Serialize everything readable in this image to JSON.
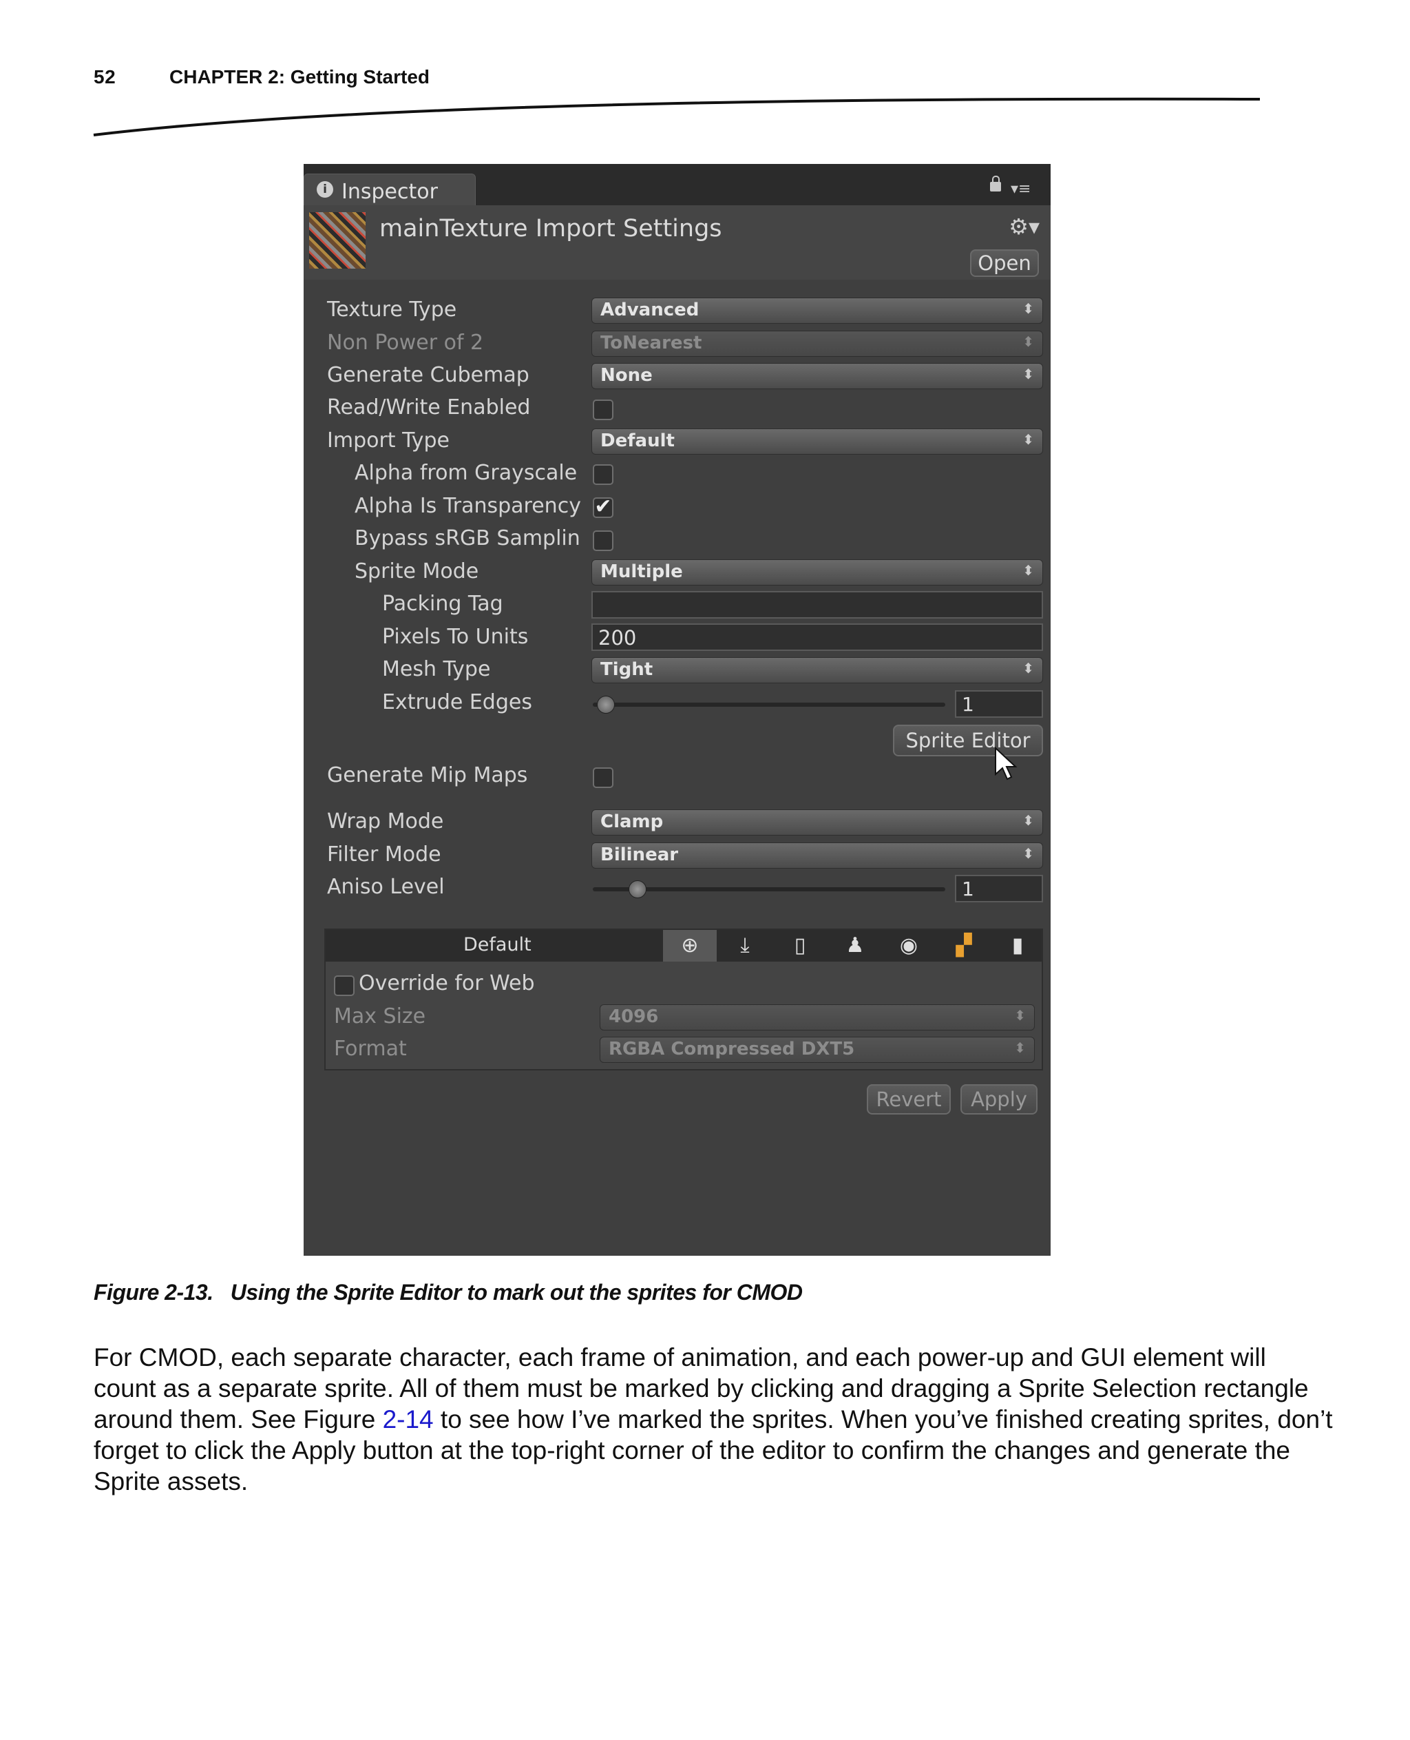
{
  "page": {
    "number": "52",
    "chapter": "CHAPTER 2: Getting Started"
  },
  "inspector": {
    "tab_label": "Inspector",
    "title": "mainTexture Import Settings",
    "open_button": "Open",
    "rows": {
      "texture_type": {
        "label": "Texture Type",
        "value": "Advanced"
      },
      "non_power_of_2": {
        "label": "Non Power of 2",
        "value": "ToNearest"
      },
      "generate_cubemap": {
        "label": "Generate Cubemap",
        "value": "None"
      },
      "read_write_enabled": {
        "label": "Read/Write Enabled",
        "checked": false
      },
      "import_type": {
        "label": "Import Type",
        "value": "Default"
      },
      "alpha_from_grayscale": {
        "label": "Alpha from Grayscale",
        "checked": false
      },
      "alpha_is_transparency": {
        "label": "Alpha Is Transparency",
        "checked": true,
        "mark": "✔"
      },
      "bypass_srgb": {
        "label": "Bypass sRGB Samplin",
        "checked": false
      },
      "sprite_mode": {
        "label": "Sprite Mode",
        "value": "Multiple"
      },
      "packing_tag": {
        "label": "Packing Tag",
        "value": ""
      },
      "pixels_to_units": {
        "label": "Pixels To Units",
        "value": "200"
      },
      "mesh_type": {
        "label": "Mesh Type",
        "value": "Tight"
      },
      "extrude_edges": {
        "label": "Extrude Edges",
        "value": "1"
      },
      "generate_mip_maps": {
        "label": "Generate Mip Maps",
        "checked": false
      },
      "wrap_mode": {
        "label": "Wrap Mode",
        "value": "Clamp"
      },
      "filter_mode": {
        "label": "Filter Mode",
        "value": "Bilinear"
      },
      "aniso_level": {
        "label": "Aniso Level",
        "value": "1"
      }
    },
    "sprite_editor_button": "Sprite Editor",
    "platforms": {
      "default_label": "Default",
      "icons": [
        "globe-icon",
        "download-icon",
        "phone-icon",
        "android-icon",
        "blackberry-icon",
        "windows-icon",
        "mobile-device-icon"
      ],
      "override_label": "Override for Web",
      "max_size": {
        "label": "Max Size",
        "value": "4096"
      },
      "format": {
        "label": "Format",
        "value": "RGBA Compressed DXT5"
      }
    },
    "revert_button": "Revert",
    "apply_button": "Apply"
  },
  "caption": {
    "figure": "Figure 2-13.",
    "text": "Using the Sprite Editor to mark out the sprites for CMOD"
  },
  "body": {
    "p1_start": "For CMOD, each separate character, each frame of animation, and each power-up and GUI element will count as a separate sprite. All of them must be marked by clicking and dragging a Sprite Selection rectangle around them. See Figure ",
    "p1_link": "2-14",
    "p1_end": " to see how I’ve marked the sprites. When you’ve finished creating sprites, don’t forget to click the Apply button at the top-right corner of the editor to confirm the changes and generate the Sprite assets."
  }
}
